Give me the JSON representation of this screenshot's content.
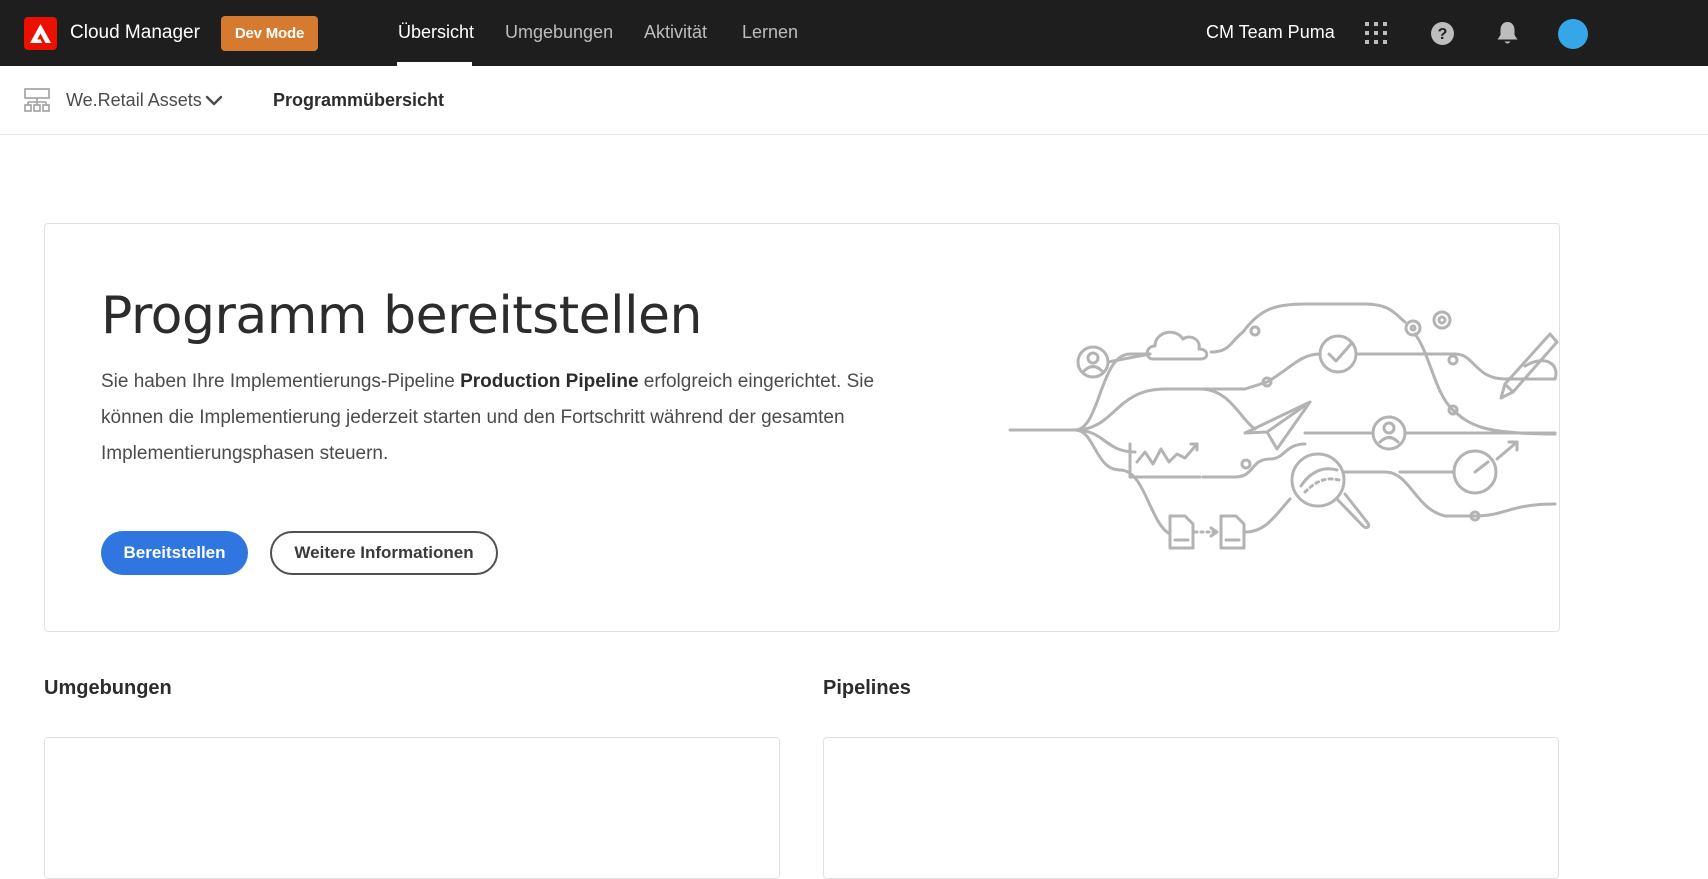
{
  "topbar": {
    "app_name": "Cloud Manager",
    "badge": "Dev Mode",
    "tabs": [
      {
        "label": "Übersicht",
        "active": true
      },
      {
        "label": "Umgebungen",
        "active": false
      },
      {
        "label": "Aktivität",
        "active": false
      },
      {
        "label": "Lernen",
        "active": false
      }
    ],
    "team": "CM Team Puma",
    "icons": [
      "apps-grid-icon",
      "help-icon",
      "bell-icon",
      "user-avatar"
    ]
  },
  "subbar": {
    "program": "We.Retail Assets",
    "title": "Programmübersicht"
  },
  "hero": {
    "title": "Programm bereitstellen",
    "text_before": "Sie haben Ihre Implementierungs-Pipeline ",
    "pipeline_name": "Production Pipeline",
    "text_after": " erfolgreich eingerichtet. Sie können die Implementierung jederzeit starten und den Fortschritt während der gesamten Implementierungsphasen steuern.",
    "primary_button": "Bereitstellen",
    "secondary_button": "Weitere Informationen"
  },
  "sections": {
    "environments_title": "Umgebungen",
    "pipelines_title": "Pipelines"
  },
  "colors": {
    "topbar_bg": "#1e1e1e",
    "brand_red": "#eb1000",
    "badge_orange": "#d57a2e",
    "primary_blue": "#2f76e0",
    "illustration_gray": "#b3b3b3"
  }
}
